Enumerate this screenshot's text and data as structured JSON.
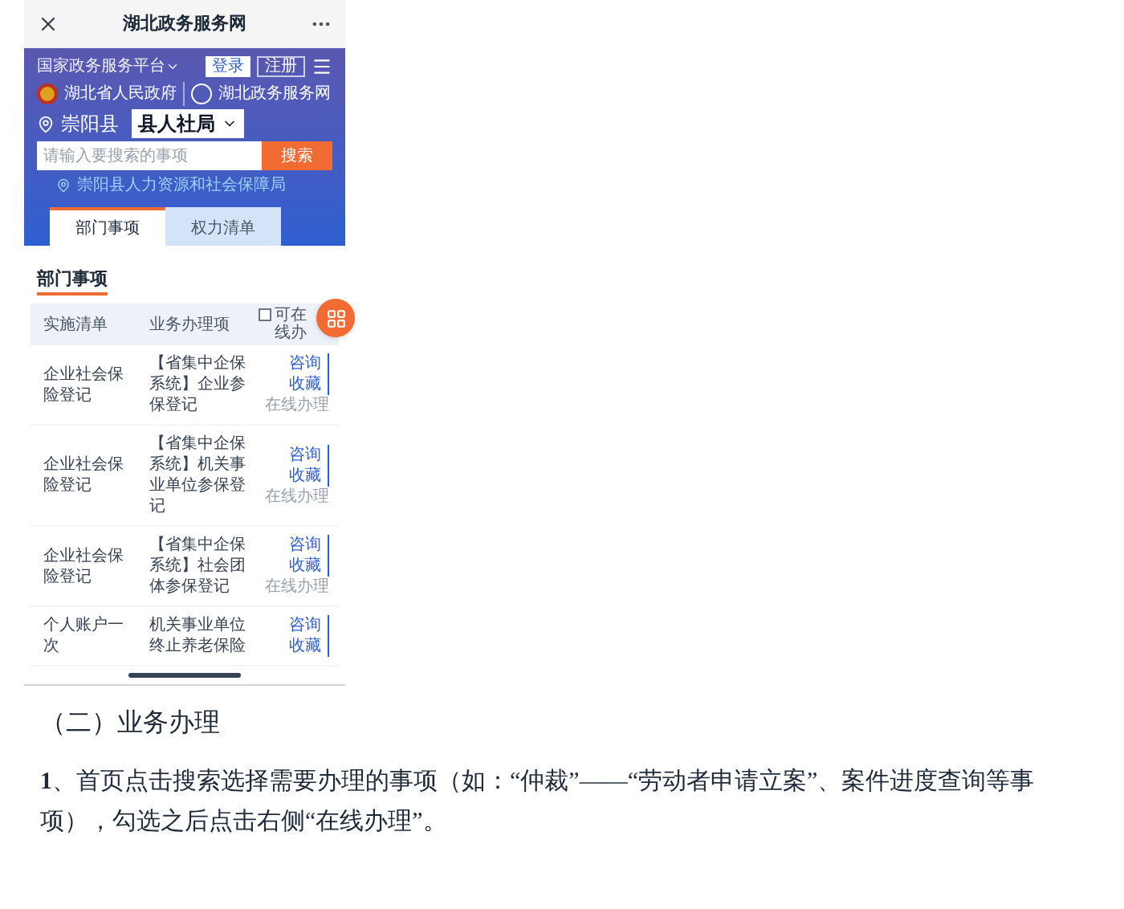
{
  "top_bar": {
    "title": "湖北政务服务网"
  },
  "header": {
    "platform": "国家政务服务平台",
    "login": "登录",
    "register": "注册",
    "gov_logo_text": "湖北省人民政府",
    "portal_logo_text": "湖北政务服务网",
    "county": "崇阳县",
    "department": "县人社局",
    "search_placeholder": "请输入要搜索的事项",
    "search_button": "搜索",
    "office": "崇阳县人力资源和社会保障局"
  },
  "tabs": [
    {
      "label": "部门事项",
      "selected": true
    },
    {
      "label": "权力清单",
      "selected": false
    }
  ],
  "section_title": "部门事项",
  "table": {
    "columns": [
      "实施清单",
      "业务办理项"
    ],
    "online_filter": {
      "label": "可在线办",
      "checked": false
    },
    "rows": [
      {
        "item": "企业社会保险登记",
        "service": "【省集中企保系统】企业参保登记",
        "actions": [
          {
            "label": "咨询",
            "disabled": false
          },
          {
            "label": "收藏",
            "disabled": false
          },
          {
            "label": "在线办理",
            "disabled": true
          }
        ]
      },
      {
        "item": "企业社会保险登记",
        "service": "【省集中企保系统】机关事业单位参保登记",
        "actions": [
          {
            "label": "咨询",
            "disabled": false
          },
          {
            "label": "收藏",
            "disabled": false
          },
          {
            "label": "在线办理",
            "disabled": true
          }
        ]
      },
      {
        "item": "企业社会保险登记",
        "service": "【省集中企保系统】社会团体参保登记",
        "actions": [
          {
            "label": "咨询",
            "disabled": false
          },
          {
            "label": "收藏",
            "disabled": false
          },
          {
            "label": "在线办理",
            "disabled": true
          }
        ]
      },
      {
        "item": "个人账户一次",
        "service": "机关事业单位终止养老保险",
        "actions": [
          {
            "label": "咨询",
            "disabled": false
          },
          {
            "label": "收藏",
            "disabled": false
          }
        ]
      }
    ]
  },
  "document": {
    "heading": "（二）业务办理",
    "paragraph": "**1**、首页点击搜索选择需要办理的事项（如：“仲裁”——“劳动者申请立案”、案件进度查询等事项），勾选之后点击右侧“在线办理”。"
  }
}
